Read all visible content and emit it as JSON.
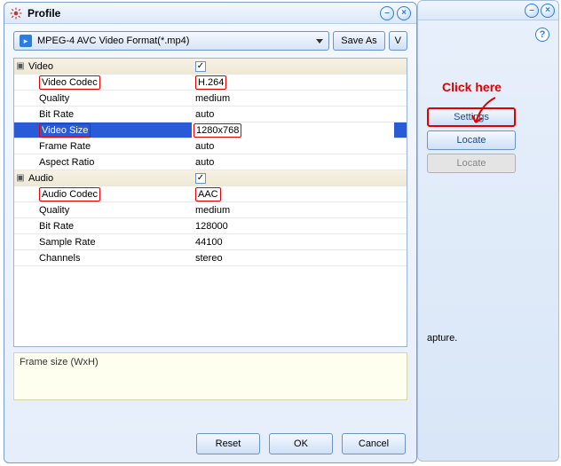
{
  "bg": {
    "help_tip": "?",
    "buttons": {
      "settings": "Settings",
      "locate": "Locate",
      "locate2": "Locate"
    },
    "partial": "apture."
  },
  "dialog": {
    "title": "Profile",
    "format_selected": "MPEG-4 AVC Video Format(*.mp4)",
    "save_as": "Save As",
    "v_btn": "V",
    "hint": "Frame size (WxH)",
    "footer": {
      "reset": "Reset",
      "ok": "OK",
      "cancel": "Cancel"
    }
  },
  "sections": {
    "video": {
      "label": "Video",
      "checked": true,
      "rows": {
        "codec_lbl": "Video Codec",
        "codec_val": "H.264",
        "quality_lbl": "Quality",
        "quality_val": "medium",
        "bitrate_lbl": "Bit Rate",
        "bitrate_val": "auto",
        "size_lbl": "Video Size",
        "size_val": "1280x768",
        "fps_lbl": "Frame Rate",
        "fps_val": "auto",
        "aspect_lbl": "Aspect Ratio",
        "aspect_val": "auto"
      }
    },
    "audio": {
      "label": "Audio",
      "checked": true,
      "rows": {
        "codec_lbl": "Audio Codec",
        "codec_val": "AAC",
        "quality_lbl": "Quality",
        "quality_val": "medium",
        "bitrate_lbl": "Bit Rate",
        "bitrate_val": "128000",
        "sample_lbl": "Sample Rate",
        "sample_val": "44100",
        "channels_lbl": "Channels",
        "channels_val": "stereo"
      }
    }
  },
  "annotation": {
    "text": "Click here"
  }
}
